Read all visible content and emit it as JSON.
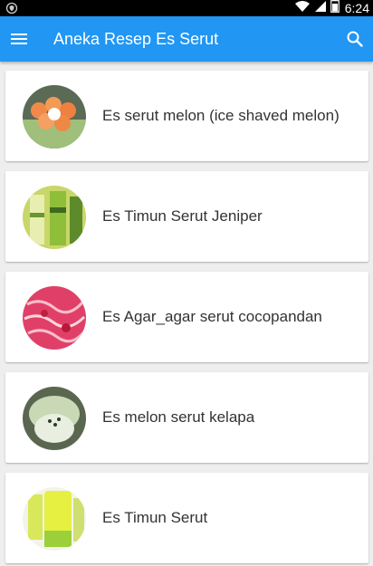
{
  "status_bar": {
    "time": "6:24",
    "notification_icon": "shield-notification-icon",
    "icons": [
      "wifi-icon",
      "signal-icon",
      "battery-icon"
    ]
  },
  "app_bar": {
    "title": "Aneka Resep Es Serut",
    "menu_icon": "hamburger-menu-icon",
    "search_icon": "search-icon",
    "background": "#2196f3"
  },
  "recipes": [
    {
      "label": "Es serut melon (ice shaved melon)",
      "thumbnail": "melon-balls-thumbnail"
    },
    {
      "label": "Es Timun Serut Jeniper",
      "thumbnail": "cucumber-drink-thumbnail"
    },
    {
      "label": "Es Agar_agar serut cocopandan",
      "thumbnail": "pink-agar-thumbnail"
    },
    {
      "label": "Es melon serut kelapa",
      "thumbnail": "melon-coconut-thumbnail"
    },
    {
      "label": "Es Timun Serut",
      "thumbnail": "green-drink-thumbnail"
    }
  ]
}
